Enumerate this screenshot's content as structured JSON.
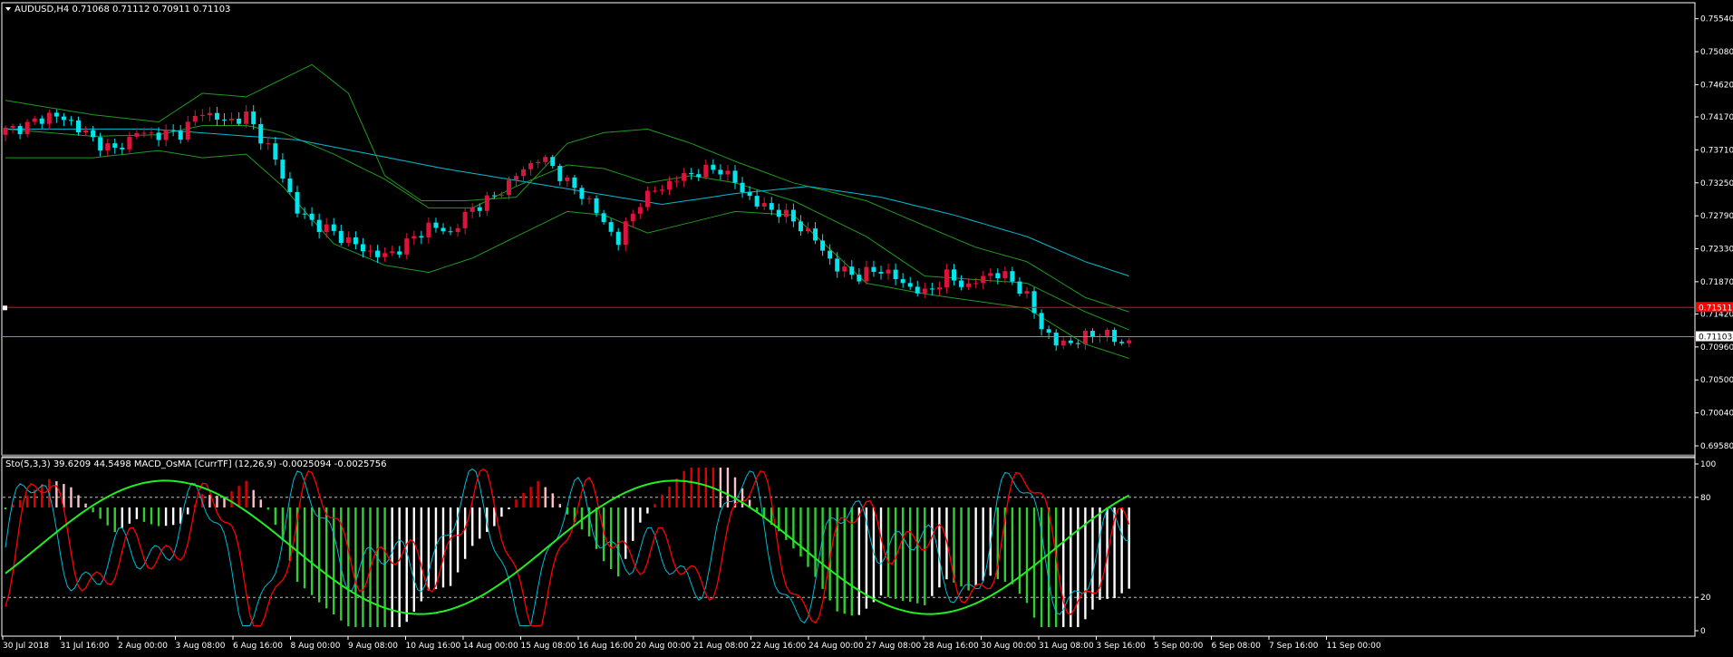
{
  "window": {
    "symbol_header": "AUDUSD,H4  0.71068 0.71112 0.70911 0.71103",
    "sub_header": "Sto(5,3,3) 39.6209 44.5498   MACD_OsMA [CurrTF] (12,26,9) -0.0025094 -0.0025756"
  },
  "colors": {
    "background": "#000000",
    "bull_candle": "#dc143c",
    "bear_candle": "#00e5ee",
    "bollinger": "#1f9a1f",
    "moving_average": "#00bcd4",
    "hline_red": "#ff0000",
    "hline_current": "#3fa9c4",
    "histogram_up": "#e00000",
    "histogram_up_weak": "#ffc0cb",
    "histogram_down": "#33cc33",
    "histogram_down_weak": "#ffffff",
    "stoch_main": "#00bcd4",
    "stoch_signal": "#ff0000",
    "macd_signal": "#22ee22"
  },
  "price_axis": {
    "ticks": [
      "0.75540",
      "0.75080",
      "0.74620",
      "0.74170",
      "0.73710",
      "0.73250",
      "0.72790",
      "0.72330",
      "0.71870",
      "0.71420",
      "0.70960",
      "0.70500",
      "0.70040",
      "0.69580"
    ],
    "red_line_label": "0.71511",
    "current_price_label": "0.71103"
  },
  "indicator_axis": {
    "ticks": [
      "100",
      "80",
      "20",
      "0"
    ]
  },
  "time_axis": {
    "labels": [
      "30 Jul 2018",
      "31 Jul 16:00",
      "2 Aug 00:00",
      "3 Aug 08:00",
      "6 Aug 16:00",
      "8 Aug 00:00",
      "9 Aug 08:00",
      "10 Aug 16:00",
      "14 Aug 00:00",
      "15 Aug 08:00",
      "16 Aug 16:00",
      "20 Aug 00:00",
      "21 Aug 08:00",
      "22 Aug 16:00",
      "24 Aug 00:00",
      "27 Aug 08:00",
      "28 Aug 16:00",
      "30 Aug 00:00",
      "31 Aug 08:00",
      "3 Sep 16:00",
      "5 Sep 00:00",
      "6 Sep 08:00",
      "7 Sep 16:00",
      "11 Sep 00:00"
    ]
  },
  "chart_data": {
    "type": "candlestick",
    "symbol": "AUDUSD",
    "timeframe": "H4",
    "last_bar": {
      "open": 0.71068,
      "high": 0.71112,
      "low": 0.70911,
      "close": 0.71103
    },
    "ylim": [
      0.6958,
      0.757
    ],
    "horizontal_lines": [
      0.71511,
      0.71103
    ],
    "close_path": [
      [
        0,
        0.7398
      ],
      [
        3,
        0.7405
      ],
      [
        6,
        0.742
      ],
      [
        9,
        0.741
      ],
      [
        12,
        0.7385
      ],
      [
        15,
        0.737
      ],
      [
        18,
        0.7395
      ],
      [
        21,
        0.7392
      ],
      [
        24,
        0.7395
      ],
      [
        27,
        0.7425
      ],
      [
        30,
        0.741
      ],
      [
        33,
        0.7418
      ],
      [
        36,
        0.7375
      ],
      [
        38,
        0.7335
      ],
      [
        40,
        0.7285
      ],
      [
        43,
        0.7265
      ],
      [
        46,
        0.725
      ],
      [
        49,
        0.7232
      ],
      [
        52,
        0.7222
      ],
      [
        55,
        0.724
      ],
      [
        58,
        0.7265
      ],
      [
        61,
        0.7255
      ],
      [
        64,
        0.729
      ],
      [
        67,
        0.7305
      ],
      [
        70,
        0.7335
      ],
      [
        73,
        0.736
      ],
      [
        75,
        0.7348
      ],
      [
        77,
        0.7325
      ],
      [
        80,
        0.73
      ],
      [
        82,
        0.7268
      ],
      [
        84,
        0.7245
      ],
      [
        87,
        0.73
      ],
      [
        90,
        0.732
      ],
      [
        93,
        0.7335
      ],
      [
        95,
        0.734
      ],
      [
        98,
        0.7345
      ],
      [
        100,
        0.7325
      ],
      [
        103,
        0.7295
      ],
      [
        106,
        0.7285
      ],
      [
        109,
        0.7265
      ],
      [
        111,
        0.7245
      ],
      [
        114,
        0.7205
      ],
      [
        117,
        0.7195
      ],
      [
        120,
        0.7205
      ],
      [
        123,
        0.7185
      ],
      [
        126,
        0.717
      ],
      [
        129,
        0.7195
      ],
      [
        132,
        0.718
      ],
      [
        135,
        0.72
      ],
      [
        138,
        0.719
      ],
      [
        140,
        0.7165
      ],
      [
        142,
        0.7125
      ],
      [
        144,
        0.71
      ],
      [
        147,
        0.7105
      ],
      [
        150,
        0.7118
      ],
      [
        152,
        0.7105
      ],
      [
        154,
        0.7103
      ]
    ],
    "bollinger": {
      "upper": [
        [
          0,
          0.744
        ],
        [
          12,
          0.742
        ],
        [
          21,
          0.741
        ],
        [
          27,
          0.745
        ],
        [
          33,
          0.7445
        ],
        [
          38,
          0.747
        ],
        [
          42,
          0.749
        ],
        [
          47,
          0.745
        ],
        [
          52,
          0.7335
        ],
        [
          57,
          0.73
        ],
        [
          63,
          0.73
        ],
        [
          70,
          0.7305
        ],
        [
          77,
          0.738
        ],
        [
          82,
          0.7395
        ],
        [
          88,
          0.74
        ],
        [
          94,
          0.738
        ],
        [
          100,
          0.7355
        ],
        [
          108,
          0.7325
        ],
        [
          118,
          0.73
        ],
        [
          126,
          0.7265
        ],
        [
          133,
          0.7235
        ],
        [
          140,
          0.7215
        ],
        [
          148,
          0.7165
        ],
        [
          154,
          0.7145
        ]
      ],
      "middle": [
        [
          0,
          0.74
        ],
        [
          12,
          0.739
        ],
        [
          21,
          0.7392
        ],
        [
          27,
          0.7405
        ],
        [
          33,
          0.7405
        ],
        [
          38,
          0.7395
        ],
        [
          45,
          0.7365
        ],
        [
          52,
          0.733
        ],
        [
          58,
          0.729
        ],
        [
          64,
          0.729
        ],
        [
          70,
          0.732
        ],
        [
          77,
          0.735
        ],
        [
          82,
          0.7345
        ],
        [
          88,
          0.7325
        ],
        [
          94,
          0.7335
        ],
        [
          100,
          0.7325
        ],
        [
          108,
          0.73
        ],
        [
          118,
          0.725
        ],
        [
          126,
          0.7195
        ],
        [
          133,
          0.719
        ],
        [
          140,
          0.7185
        ],
        [
          148,
          0.7145
        ],
        [
          154,
          0.712
        ]
      ],
      "lower": [
        [
          0,
          0.736
        ],
        [
          12,
          0.736
        ],
        [
          21,
          0.737
        ],
        [
          27,
          0.736
        ],
        [
          33,
          0.7365
        ],
        [
          38,
          0.732
        ],
        [
          45,
          0.724
        ],
        [
          52,
          0.721
        ],
        [
          58,
          0.72
        ],
        [
          64,
          0.722
        ],
        [
          70,
          0.725
        ],
        [
          77,
          0.7285
        ],
        [
          82,
          0.728
        ],
        [
          88,
          0.7255
        ],
        [
          94,
          0.727
        ],
        [
          100,
          0.7285
        ],
        [
          108,
          0.728
        ],
        [
          118,
          0.7185
        ],
        [
          126,
          0.717
        ],
        [
          133,
          0.716
        ],
        [
          140,
          0.715
        ],
        [
          148,
          0.71
        ],
        [
          154,
          0.708
        ]
      ]
    },
    "moving_average": [
      [
        0,
        0.74
      ],
      [
        20,
        0.74
      ],
      [
        40,
        0.7385
      ],
      [
        60,
        0.7345
      ],
      [
        75,
        0.732
      ],
      [
        90,
        0.7295
      ],
      [
        100,
        0.731
      ],
      [
        110,
        0.732
      ],
      [
        120,
        0.7305
      ],
      [
        130,
        0.728
      ],
      [
        140,
        0.725
      ],
      [
        148,
        0.7215
      ],
      [
        154,
        0.7195
      ]
    ],
    "indicator": {
      "stoch_params": "5,3,3",
      "stoch_main": 39.6209,
      "stoch_signal": 44.5498,
      "macd_osma_params": "12,26,9",
      "osma_value": -0.0025094,
      "osma_signal": -0.0025756,
      "levels": [
        80,
        20
      ],
      "ylim": [
        0,
        100
      ]
    }
  }
}
